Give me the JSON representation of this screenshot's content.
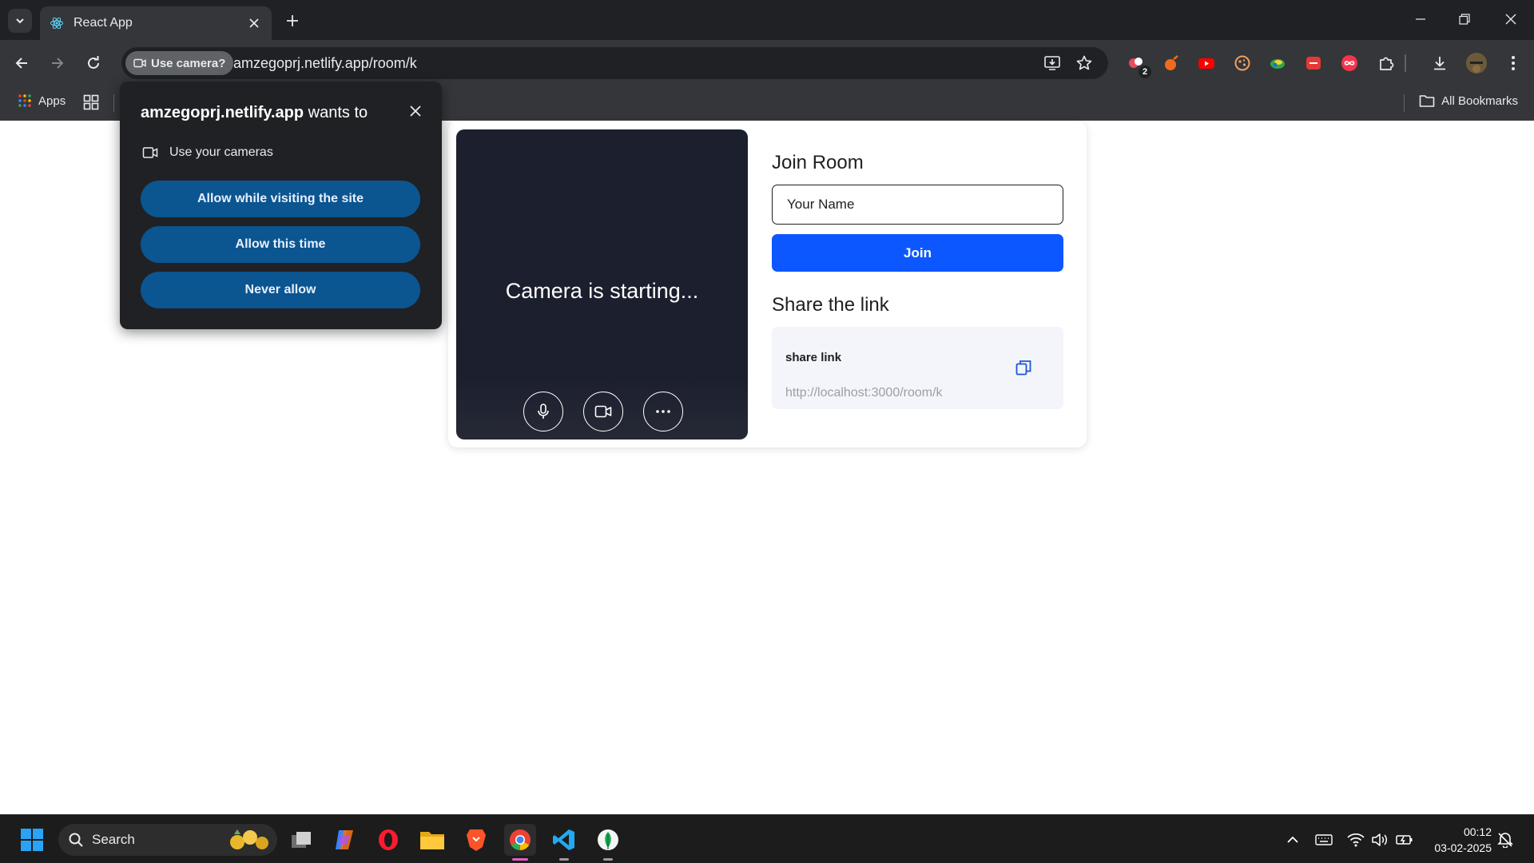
{
  "browser": {
    "tab_title": "React App",
    "url": "amzegoprj.netlify.app/room/k",
    "camera_chip": "Use camera?",
    "bookmarks": {
      "apps_label": "Apps",
      "all_bookmarks_label": "All Bookmarks"
    },
    "extension_badge": "2"
  },
  "permission_popup": {
    "site": "amzegoprj.netlify.app",
    "title_suffix": " wants to",
    "request": "Use your cameras",
    "buttons": [
      "Allow while visiting the site",
      "Allow this time",
      "Never allow"
    ]
  },
  "room": {
    "video_status": "Camera is starting...",
    "join_heading": "Join Room",
    "name_placeholder": "Your Name",
    "join_button": "Join",
    "share_heading": "Share the link",
    "share_label": "share link",
    "share_url": "http://localhost:3000/room/k"
  },
  "taskbar": {
    "search_label": "Search",
    "time": "00:12",
    "date": "03-02-2025"
  },
  "colors": {
    "chrome_dark": "#202124",
    "chrome_mid": "#35363a",
    "join_blue": "#0c57ff",
    "permission_button": "#0b5590",
    "video_bg": "#1c1f2e"
  }
}
